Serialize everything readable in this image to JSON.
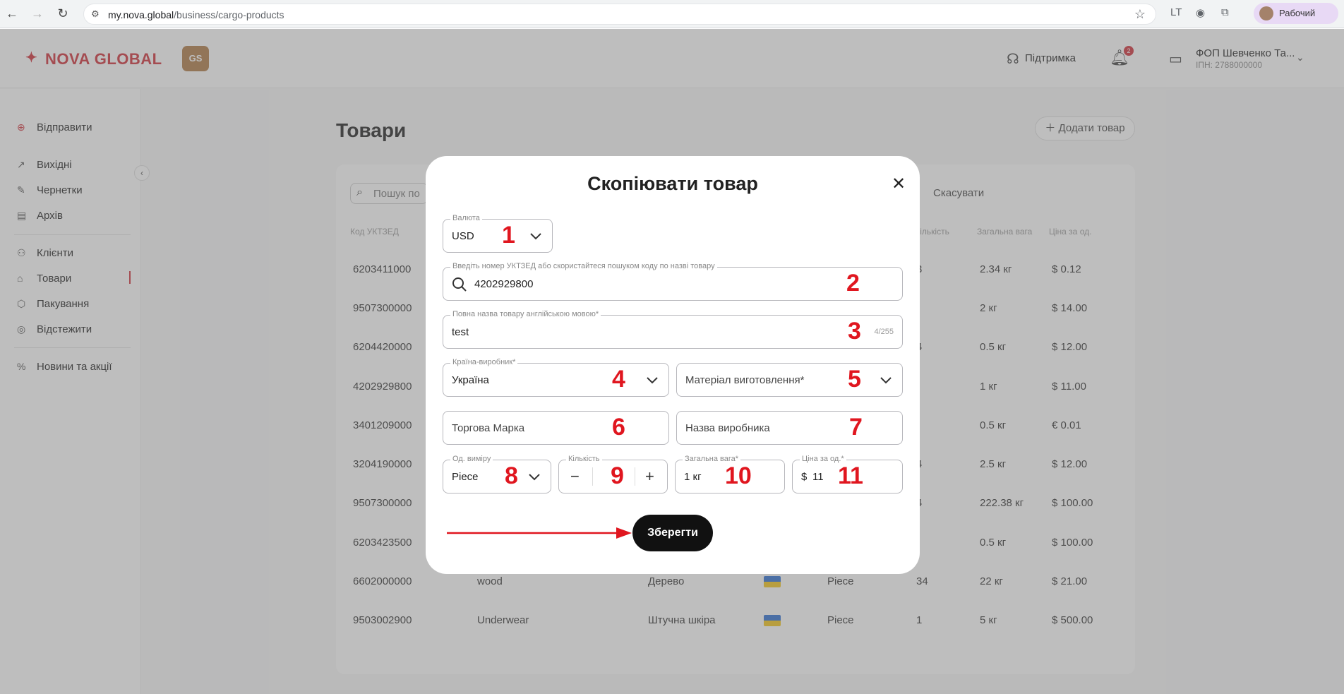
{
  "browser": {
    "url_host": "my.nova.global",
    "url_path": "/business/cargo-products",
    "profile_name": "Рабочий"
  },
  "header": {
    "logo_text": "NOVA GLOBAL",
    "gs_label": "GS",
    "support_label": "Підтримка",
    "notifications_count": "2",
    "company_name": "ФОП Шевченко Та...",
    "company_inn": "ІПН: 2788000000"
  },
  "sidebar": {
    "items": [
      {
        "label": "Відправити",
        "icon": "plus-circle-icon"
      },
      {
        "label": "Вихідні",
        "icon": "arrow-up-right-icon"
      },
      {
        "label": "Чернетки",
        "icon": "edit-icon"
      },
      {
        "label": "Архів",
        "icon": "archive-icon"
      },
      {
        "label": "Клієнти",
        "icon": "users-icon"
      },
      {
        "label": "Товари",
        "icon": "tag-icon"
      },
      {
        "label": "Пакування",
        "icon": "box-icon"
      },
      {
        "label": "Відстежити",
        "icon": "track-icon"
      },
      {
        "label": "Новини та акції",
        "icon": "percent-icon"
      }
    ]
  },
  "page": {
    "title": "Товари",
    "add_button": "Додати товар",
    "search_placeholder": "Пошук по",
    "cancel_label": "Скасувати",
    "columns": [
      "Код УКТЗЕД",
      "кількість",
      "Загальна вага",
      "Ціна за од."
    ],
    "rows": [
      {
        "code": "6203411000",
        "qty": "3",
        "weight": "2.34 кг",
        "price": "$ 0.12"
      },
      {
        "code": "9507300000",
        "qty": "",
        "weight": "2 кг",
        "price": "$ 14.00"
      },
      {
        "code": "6204420000",
        "qty": "4",
        "weight": "0.5 кг",
        "price": "$ 12.00"
      },
      {
        "code": "4202929800",
        "qty": "",
        "weight": "1 кг",
        "price": "$ 11.00"
      },
      {
        "code": "3401209000",
        "qty": "",
        "weight": "0.5 кг",
        "price": "€ 0.01"
      },
      {
        "code": "3204190000",
        "qty": "4",
        "weight": "2.5 кг",
        "price": "$ 12.00"
      },
      {
        "code": "9507300000",
        "qty": "4",
        "weight": "222.38 кг",
        "price": "$ 100.00"
      },
      {
        "code": "6203423500",
        "qty": "",
        "weight": "0.5 кг",
        "price": "$ 100.00"
      },
      {
        "code": "6602000000",
        "name": "wood",
        "material": "Дерево",
        "unit": "Piece",
        "qty": "34",
        "weight": "22 кг",
        "price": "$ 21.00"
      },
      {
        "code": "9503002900",
        "name": "Underwear",
        "material": "Штучна шкіра",
        "unit": "Piece",
        "qty": "1",
        "weight": "5 кг",
        "price": "$ 500.00"
      }
    ]
  },
  "modal": {
    "title": "Скопіювати товар",
    "currency": {
      "label": "Валюта",
      "value": "USD"
    },
    "code": {
      "label": "Введіть номер УКТЗЕД або скористайтеся пошуком коду по назві товару",
      "value": "4202929800"
    },
    "name_en": {
      "label": "Повна назва товару англійською мовою*",
      "value": "test",
      "counter": "4/255"
    },
    "country": {
      "label": "Країна-виробник*",
      "value": "Україна"
    },
    "material": {
      "placeholder": "Матеріал виготовлення*"
    },
    "brand": {
      "placeholder": "Торгова Марка"
    },
    "manufacturer": {
      "placeholder": "Назва виробника"
    },
    "unit": {
      "label": "Од. виміру",
      "value": "Piece"
    },
    "quantity": {
      "label": "Кількість",
      "minus": "−",
      "plus": "+"
    },
    "weight": {
      "label": "Загальна вага*",
      "value": "1 кг"
    },
    "price": {
      "label": "Ціна за од.*",
      "currency_symbol": "$",
      "value": "11"
    },
    "save_label": "Зберегти"
  },
  "annotations": [
    "1",
    "2",
    "3",
    "4",
    "5",
    "6",
    "7",
    "8",
    "9",
    "10",
    "11"
  ],
  "colors": {
    "brand": "#d0313a",
    "annotation": "#e0161f",
    "save_button": "#111111"
  }
}
